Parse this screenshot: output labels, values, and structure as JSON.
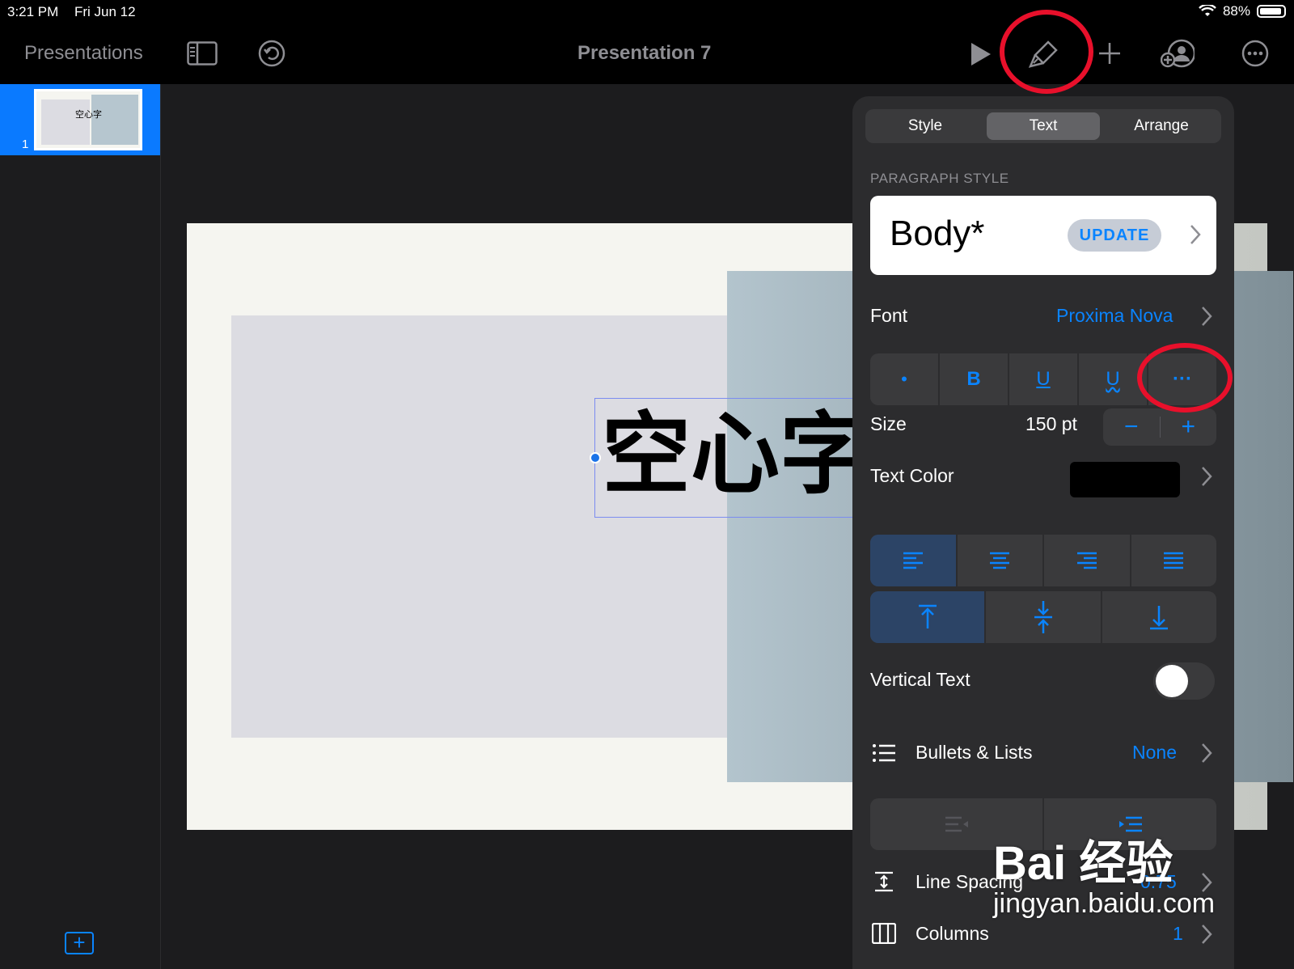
{
  "status": {
    "time": "3:21 PM",
    "date": "Fri Jun 12",
    "battery": "88%"
  },
  "toolbar": {
    "back_label": "Presentations",
    "title": "Presentation 7"
  },
  "slides": [
    {
      "number": "1",
      "text": "空心字"
    }
  ],
  "canvas": {
    "text": "空心字"
  },
  "panel": {
    "tabs": [
      "Style",
      "Text",
      "Arrange"
    ],
    "active_tab": "Text",
    "paragraph_style_header": "PARAGRAPH STYLE",
    "paragraph_style_name": "Body*",
    "update_label": "UPDATE",
    "font_label": "Font",
    "font_value": "Proxima Nova",
    "format_buttons": [
      "•",
      "B",
      "U",
      "U",
      "···"
    ],
    "size_label": "Size",
    "size_value": "150 pt",
    "text_color_label": "Text Color",
    "text_color": "#000000",
    "vertical_text_label": "Vertical Text",
    "vertical_text_on": false,
    "bullets_label": "Bullets & Lists",
    "bullets_value": "None",
    "line_spacing_label": "Line Spacing",
    "line_spacing_value": "0.75",
    "columns_label": "Columns",
    "columns_value": "1"
  },
  "watermark": {
    "brand": "Bai 经验",
    "url": "jingyan.baidu.com"
  },
  "colors": {
    "accent": "#0a84ff",
    "highlight": "#e8102b"
  }
}
